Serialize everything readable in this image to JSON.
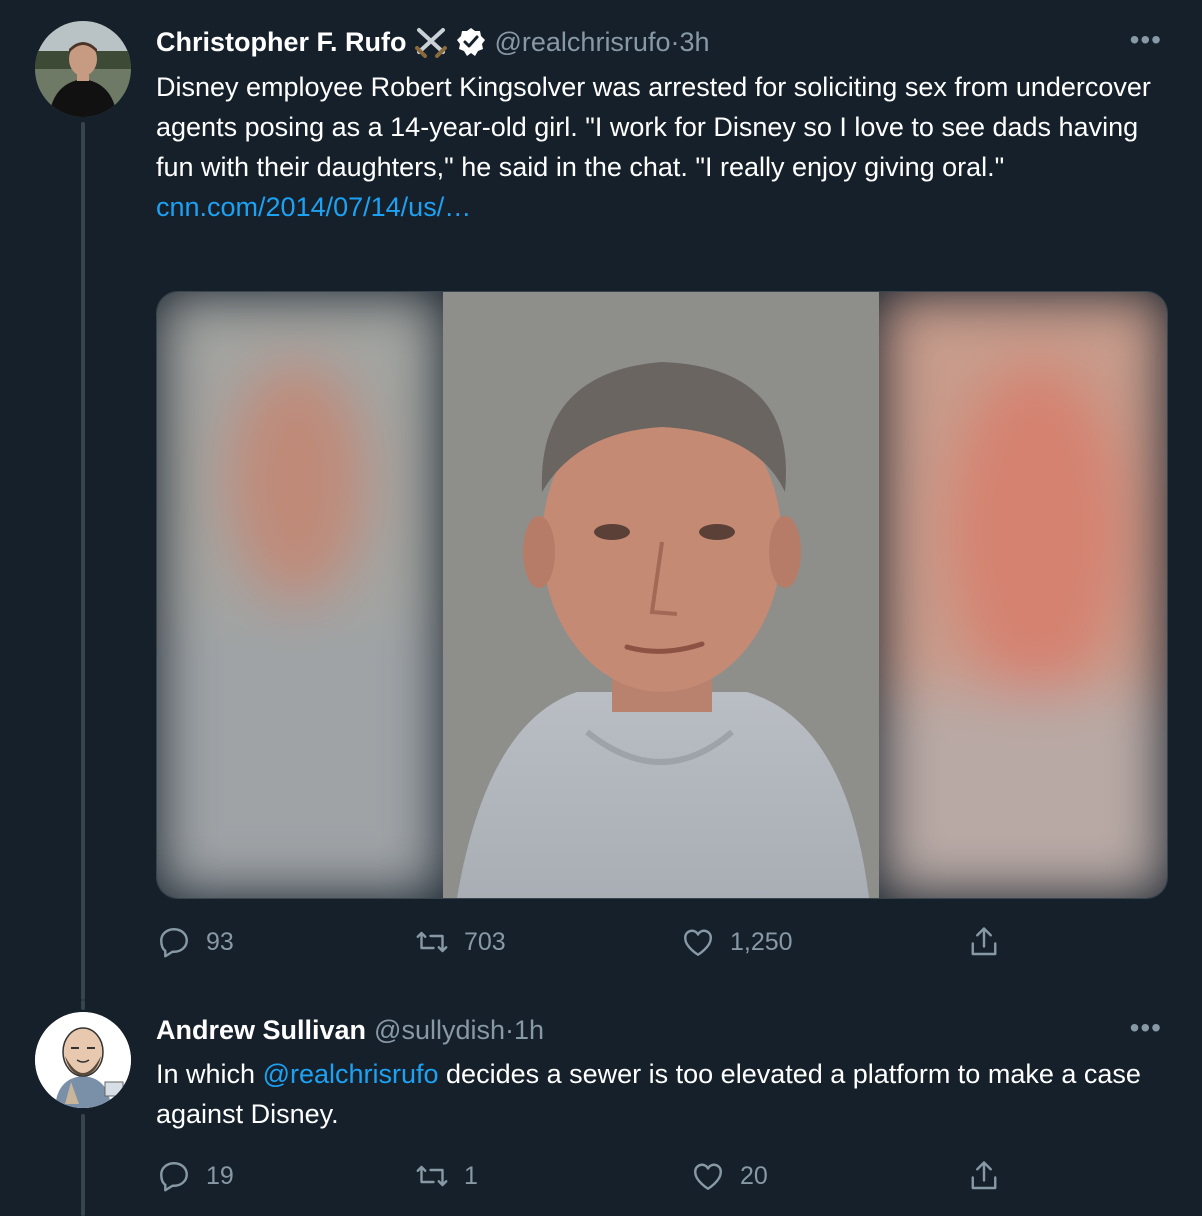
{
  "tweets": [
    {
      "author_name": "Christopher F. Rufo",
      "handle": "@realchrisrufo",
      "time": "3h",
      "text": "Disney employee Robert Kingsolver was arrested for soliciting sex from undercover agents posing as a 14-year-old girl. \"I work for Disney so I love to see dads having fun with their daughters,\" he said in the chat. \"I really enjoy giving oral.\"",
      "link": "cnn.com/2014/07/14/us/…",
      "more": "•••",
      "replies": "93",
      "retweets": "703",
      "likes": "1,250",
      "icons": [
        "crossed-swords-icon",
        "verified-badge-icon"
      ]
    },
    {
      "author_name": "Andrew Sullivan",
      "handle": "@sullydish",
      "time": "1h",
      "text_before": "In which ",
      "mention": "@realchrisrufo",
      "text_after": " decides a sewer is too elevated a platform to make a case against Disney.",
      "more": "•••",
      "replies": "19",
      "retweets": "1",
      "likes": "20"
    }
  ],
  "separator": " · ",
  "colors": {
    "background": "#15202b",
    "text": "#ffffff",
    "secondary": "#8899a6",
    "link": "#1da1f2",
    "border": "#38444d"
  }
}
